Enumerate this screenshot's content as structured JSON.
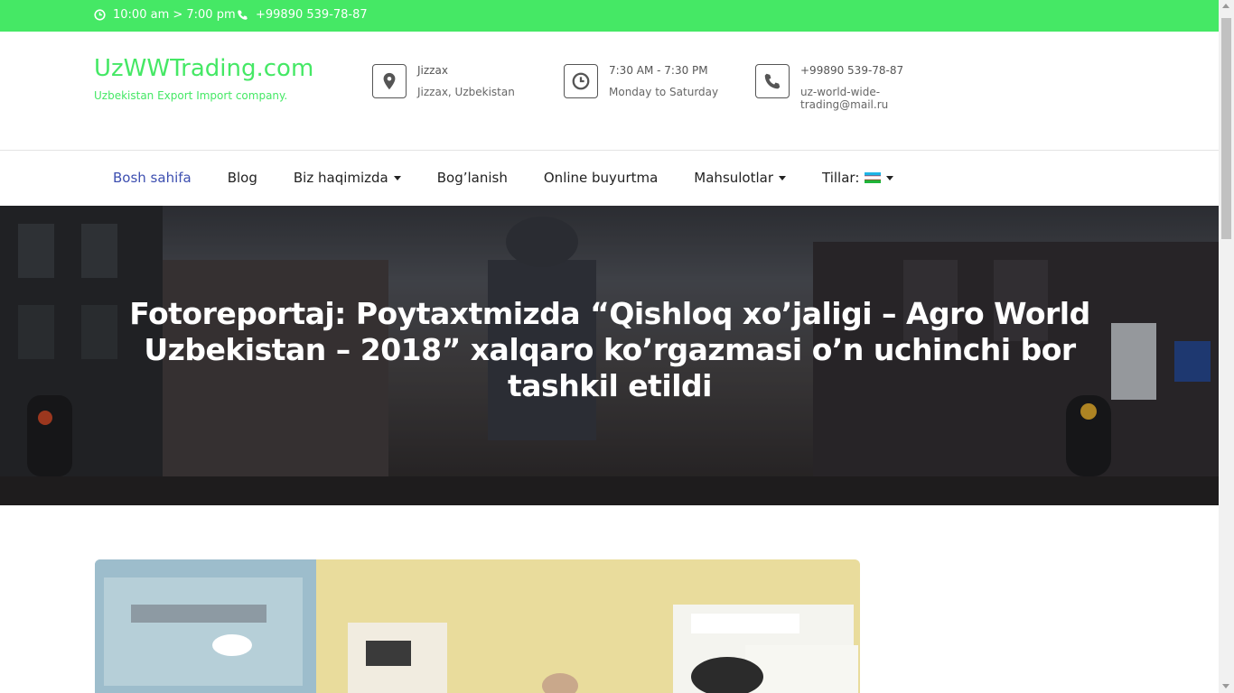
{
  "topbar": {
    "hours": "10:00 am > 7:00 pm",
    "phone": "+99890 539-78-87",
    "icons": [
      "clock-icon",
      "phone-icon"
    ]
  },
  "header": {
    "logo": "UzWWTrading.com",
    "tagline": "Uzbekistan Export Import company.",
    "location": {
      "title": "Jizzax",
      "detail": "Jizzax, Uzbekistan",
      "icon": "map-marker-icon"
    },
    "schedule": {
      "title": "7:30 AM - 7:30 PM",
      "detail": "Monday to Saturday",
      "icon": "clock-icon"
    },
    "contact": {
      "title": "+99890 539-78-87",
      "detail": "uz-world-wide-trading@mail.ru",
      "icon": "phone-icon"
    }
  },
  "nav": {
    "items": [
      {
        "label": "Bosh sahifa",
        "active": true
      },
      {
        "label": "Blog"
      },
      {
        "label": "Biz haqimizda",
        "dropdown": true
      },
      {
        "label": "Bog’lanish"
      },
      {
        "label": "Online buyurtma"
      },
      {
        "label": "Mahsulotlar",
        "dropdown": true
      },
      {
        "label": "Tillar:",
        "dropdown": true,
        "flag": "uzbekistan-flag-icon"
      }
    ]
  },
  "hero": {
    "title": "Fotoreportaj: Poytaxtmizda “Qishloq xo’jaligi – Agro World Uzbekistan – 2018” xalqaro ko’rgazmasi o’n uchinchi bor tashkil etildi"
  },
  "colors": {
    "accent": "#45e865",
    "nav_active": "#3d4fb0"
  }
}
